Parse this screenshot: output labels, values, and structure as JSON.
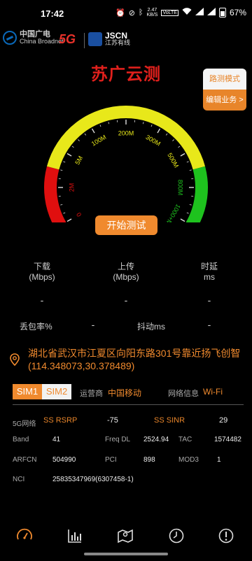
{
  "status_bar": {
    "time": "17:42",
    "net_speed_value": "2.47",
    "net_speed_unit": "KB/S",
    "signal": "VoLTE",
    "battery": "67%"
  },
  "logos": {
    "broadcast_cn": "中国广电",
    "broadcast_en": "China Broadnet",
    "fiveg": "5G",
    "jscn_en": "JSCN",
    "jscn_cn": "江苏有线"
  },
  "title": "苏广云测",
  "side_menu": {
    "mode": "路测模式",
    "business": "编辑业务 >"
  },
  "gauge": {
    "labels": [
      "0",
      "2M",
      "5M",
      "100M",
      "200M",
      "300M",
      "500M",
      "800M",
      "1000+M"
    ],
    "colors": {
      "red": "#e00f0f",
      "yellow": "#e8e81a",
      "green": "#1ec21e"
    }
  },
  "start_button": "开始测试",
  "metrics": {
    "download": {
      "label": "下载",
      "unit": "(Mbps)",
      "value": "-"
    },
    "upload": {
      "label": "上传",
      "unit": "(Mbps)",
      "value": "-"
    },
    "latency": {
      "label": "时延",
      "unit": "ms",
      "value": "-"
    },
    "packet_loss": {
      "label": "丢包率%",
      "value": "-"
    },
    "jitter": {
      "label": "抖动ms",
      "value": "-"
    }
  },
  "location": {
    "address": "湖北省武汉市江夏区向阳东路301号靠近扬飞创智",
    "coords": "(114.348073,30.378489)"
  },
  "sim": {
    "tab1": "SIM1",
    "tab2": "SIM2",
    "operator_label": "运营商",
    "operator_value": "中国移动",
    "network_label": "网络信息",
    "network_value": "Wi-Fi"
  },
  "cell_info": {
    "net_label": "5G网络",
    "rsrp_label": "SS RSRP",
    "rsrp_value": "-75",
    "sinr_label": "SS SINR",
    "sinr_value": "29",
    "band_label": "Band",
    "band_value": "41",
    "freq_label": "Freq DL",
    "freq_value": "2524.94",
    "tac_label": "TAC",
    "tac_value": "1574482",
    "arfcn_label": "ARFCN",
    "arfcn_value": "504990",
    "pci_label": "PCI",
    "pci_value": "898",
    "mod3_label": "MOD3",
    "mod3_value": "1",
    "nci_label": "NCI",
    "nci_value": "25835347969(6307458-1)"
  },
  "nav": [
    "speed-gauge-icon",
    "bar-chart-icon",
    "map-icon",
    "history-clock-icon",
    "info-icon"
  ],
  "accent": "#f08a2e"
}
